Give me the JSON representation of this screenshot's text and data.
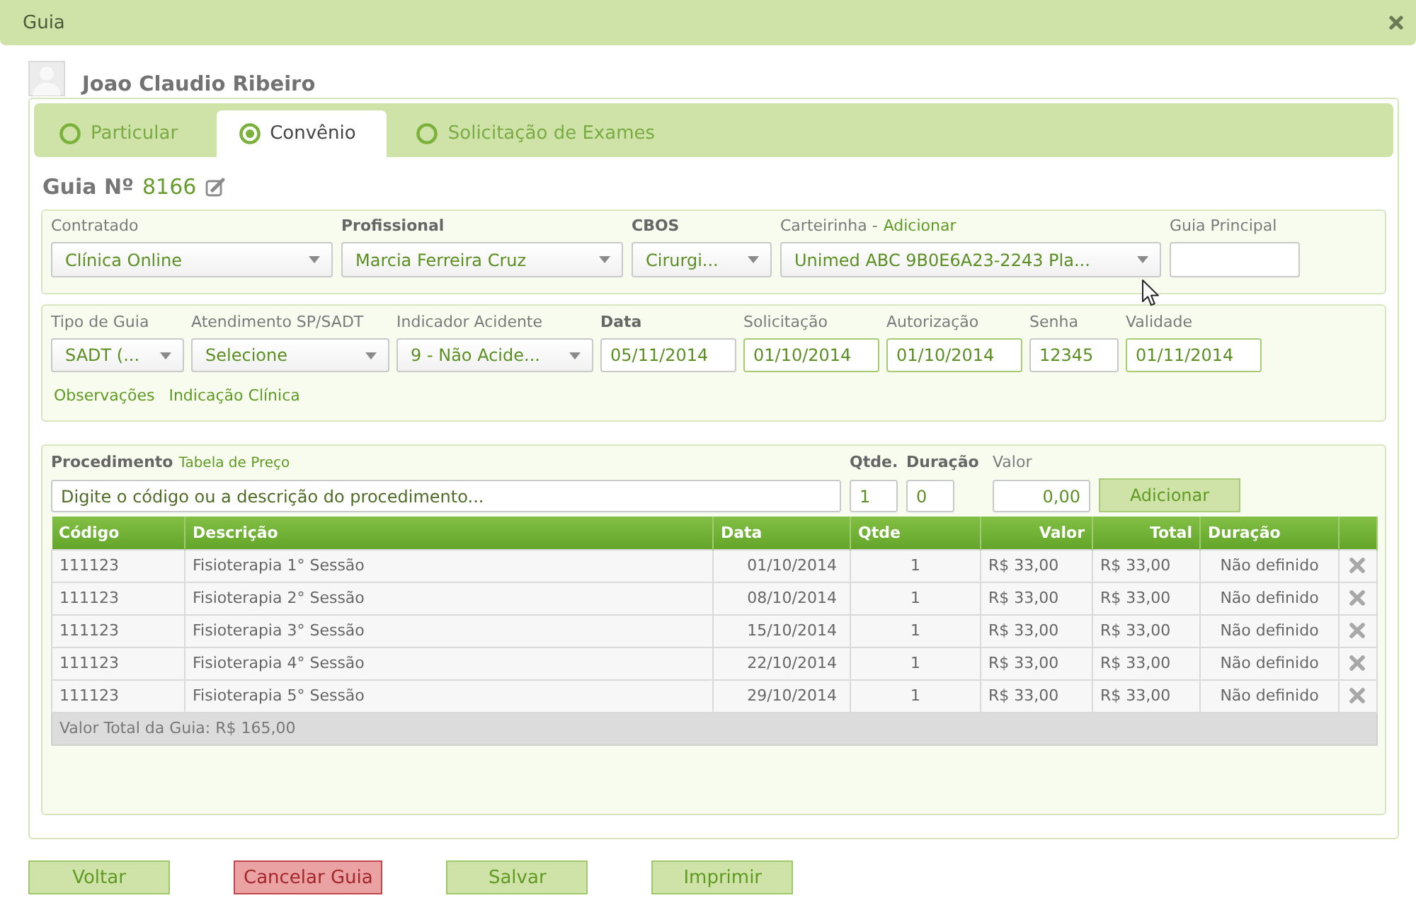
{
  "window": {
    "title": "Guia"
  },
  "patient": {
    "name": "Joao Claudio Ribeiro"
  },
  "tabs": [
    {
      "label": "Particular",
      "selected": false
    },
    {
      "label": "Convênio",
      "selected": true
    },
    {
      "label": "Solicitação de Exames",
      "selected": false
    }
  ],
  "guide": {
    "label": "Guia Nº",
    "number": "8166"
  },
  "contract_fields": [
    {
      "kind": "select",
      "label": "Contratado",
      "bold": false,
      "value": "Clínica Online"
    },
    {
      "kind": "select",
      "label": "Profissional",
      "bold": true,
      "value": "Marcia Ferreira Cruz"
    },
    {
      "kind": "select",
      "label": "CBOS",
      "bold": true,
      "value": "Cirurgi..."
    },
    {
      "kind": "select",
      "label": "Carteirinha -",
      "link": "Adicionar",
      "bold": false,
      "value": "Unimed ABC 9B0E6A23-2243 Pla..."
    },
    {
      "kind": "input",
      "label": "Guia Principal",
      "bold": false,
      "highlighted": false
    }
  ],
  "guide_fields": [
    {
      "kind": "select",
      "label": "Tipo de Guia",
      "bold": false,
      "value": "SADT (..."
    },
    {
      "kind": "select",
      "label": "Atendimento SP/SADT",
      "bold": false,
      "value": "Selecione"
    },
    {
      "kind": "select",
      "label": "Indicador Acidente",
      "bold": false,
      "value": "9 - Não Acide..."
    },
    {
      "kind": "input",
      "label": "Data",
      "bold": true,
      "value": "05/11/2014",
      "highlighted": false
    },
    {
      "kind": "input",
      "label": "Solicitação",
      "bold": false,
      "value": "01/10/2014",
      "highlighted": true
    },
    {
      "kind": "input",
      "label": "Autorização",
      "bold": false,
      "value": "01/10/2014",
      "highlighted": true
    },
    {
      "kind": "input",
      "label": "Senha",
      "bold": false,
      "value": "12345",
      "highlighted": false
    },
    {
      "kind": "input",
      "label": "Validade",
      "bold": false,
      "value": "01/11/2014",
      "highlighted": true
    }
  ],
  "guide_links": [
    "Observações",
    "Indicação Clínica"
  ],
  "procedure": {
    "label": "Procedimento",
    "price_table_link": "Tabela de Preço",
    "placeholder": "Digite o código ou a descrição do procedimento...",
    "quantity": {
      "label": "Qtde.",
      "bold": true,
      "value": "1"
    },
    "duration": {
      "label": "Duração",
      "bold": true,
      "value": "0"
    },
    "amount": {
      "label": "Valor",
      "bold": false,
      "value": "0,00"
    },
    "add_button": "Adicionar"
  },
  "table": {
    "columns": [
      "Código",
      "Descrição",
      "Data",
      "Qtde",
      "Valor",
      "Total",
      "Duração"
    ],
    "rows": [
      {
        "code": "111123",
        "description": "Fisioterapia 1° Sessão",
        "date": "01/10/2014",
        "quantity": "1",
        "value": "R$ 33,00",
        "total": "R$ 33,00",
        "duration": "Não definido"
      },
      {
        "code": "111123",
        "description": "Fisioterapia 2° Sessão",
        "date": "08/10/2014",
        "quantity": "1",
        "value": "R$ 33,00",
        "total": "R$ 33,00",
        "duration": "Não definido"
      },
      {
        "code": "111123",
        "description": "Fisioterapia 3° Sessão",
        "date": "15/10/2014",
        "quantity": "1",
        "value": "R$ 33,00",
        "total": "R$ 33,00",
        "duration": "Não definido"
      },
      {
        "code": "111123",
        "description": "Fisioterapia 4° Sessão",
        "date": "22/10/2014",
        "quantity": "1",
        "value": "R$ 33,00",
        "total": "R$ 33,00",
        "duration": "Não definido"
      },
      {
        "code": "111123",
        "description": "Fisioterapia 5° Sessão",
        "date": "29/10/2014",
        "quantity": "1",
        "value": "R$ 33,00",
        "total": "R$ 33,00",
        "duration": "Não definido"
      }
    ],
    "footer": "Valor Total da Guia: R$ 165,00"
  },
  "buttons": [
    {
      "label": "Voltar",
      "kind": "default"
    },
    {
      "label": "Cancelar Guia",
      "kind": "danger"
    },
    {
      "label": "Salvar",
      "kind": "default"
    },
    {
      "label": "Imprimir",
      "kind": "default"
    }
  ]
}
